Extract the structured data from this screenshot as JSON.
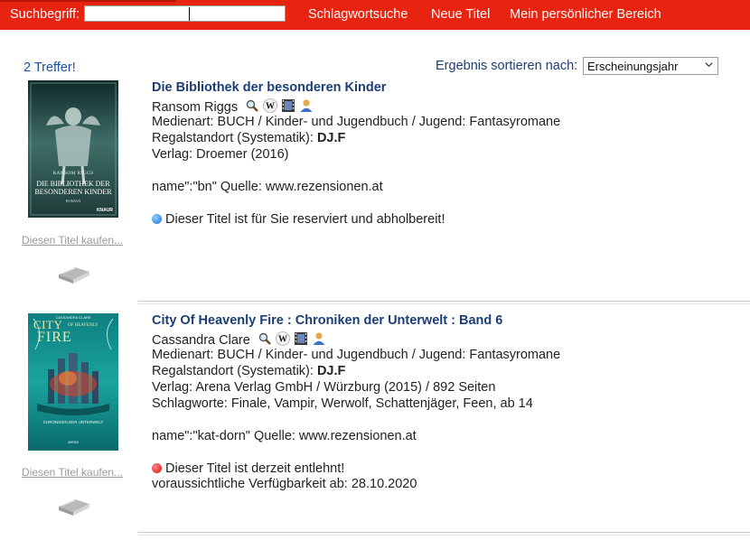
{
  "topbar": {
    "search_label": "Suchbegriff:",
    "search_value": "",
    "nav": [
      {
        "label": "Schlagwortsuche"
      },
      {
        "label": "Neue Titel"
      },
      {
        "label": "Mein persönlicher Bereich"
      }
    ]
  },
  "results": {
    "hits_label": "2 Treffer!",
    "sort_label": "Ergebnis sortieren nach:",
    "sort_value": "Erscheinungsjahr"
  },
  "items": [
    {
      "title": "Die Bibliothek der besonderen Kinder",
      "author": "Ransom Riggs",
      "medium": "Medienart: BUCH / Kinder- und Jugendbuch / Jugend: Fantasyromane",
      "shelf_label": "Regalstandort (Systematik): ",
      "shelf_value": "DJ.F",
      "publisher": "Verlag: Droemer (2016)",
      "source": "name\":\"bn\" Quelle: www.rezensionen.at",
      "status": "Dieser Titel ist für Sie reserviert und abholbereit!",
      "status_color": "#2a7fd8",
      "buy_label": "Diesen Titel kaufen...",
      "cover": {
        "author": "RANSOM RIGGS",
        "title": "DIE BIBLIOTHEK DER BESONDEREN KINDER",
        "tag": "ROMAN",
        "brand": "KNAUR"
      }
    },
    {
      "title": "City Of Heavenly Fire : Chroniken der Unterwelt : Band 6",
      "author": "Cassandra Clare",
      "medium": "Medienart: BUCH / Kinder- und Jugendbuch / Jugend: Fantasyromane",
      "shelf_label": "Regalstandort (Systematik): ",
      "shelf_value": "DJ.F",
      "publisher": "Verlag: Arena Verlag GmbH / Würzburg (2015) / 892 Seiten",
      "keywords": "Schlagworte: Finale, Vampir, Werwolf, Schattenjäger, Feen, ab 14",
      "source": "name\":\"kat-dorn\" Quelle: www.rezensionen.at",
      "status": "Dieser Titel ist derzeit entlehnt!",
      "status_color": "#e01010",
      "availability": "voraussichtliche Verfügbarkeit ab: 28.10.2020",
      "buy_label": "Diesen Titel kaufen...",
      "cover": {
        "author": "CASSANDRA CLARE",
        "title_a": "CITY",
        "title_b": "OF HEAVENLY",
        "title_c": "FIRE",
        "series": "CHRONIKEN DER UNTERWELT",
        "brand": "arena"
      }
    }
  ]
}
